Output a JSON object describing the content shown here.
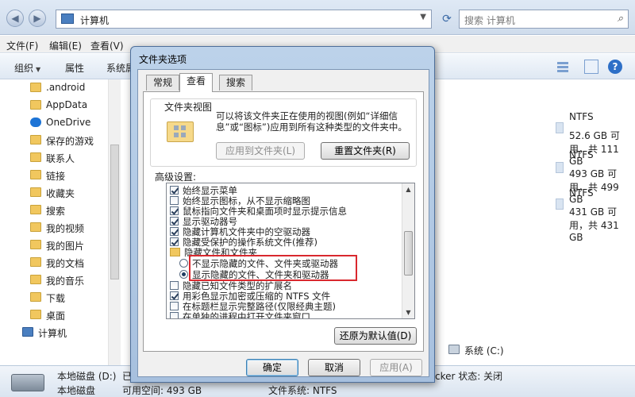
{
  "explorer": {
    "breadcrumb": "计算机",
    "search_placeholder": "搜索 计算机",
    "menu": [
      "文件(F)",
      "编辑(E)",
      "查看(V)",
      "工具(T)",
      "帮助(H)"
    ],
    "commands": {
      "organize": "组织",
      "properties": "属性",
      "system_properties": "系统属"
    },
    "nav_items": [
      {
        "label": ".android",
        "icon": "folder-icon"
      },
      {
        "label": "AppData",
        "icon": "folder-icon"
      },
      {
        "label": "OneDrive",
        "icon": "cloud-icon"
      },
      {
        "label": "保存的游戏",
        "icon": "folder-icon"
      },
      {
        "label": "联系人",
        "icon": "contacts-icon"
      },
      {
        "label": "链接",
        "icon": "folder-icon"
      },
      {
        "label": "收藏夹",
        "icon": "folder-icon"
      },
      {
        "label": "搜索",
        "icon": "folder-icon"
      },
      {
        "label": "我的视频",
        "icon": "folder-icon"
      },
      {
        "label": "我的图片",
        "icon": "folder-icon"
      },
      {
        "label": "我的文档",
        "icon": "folder-icon"
      },
      {
        "label": "我的音乐",
        "icon": "folder-icon"
      },
      {
        "label": "下载",
        "icon": "folder-icon"
      },
      {
        "label": "桌面",
        "icon": "folder-icon"
      },
      {
        "label": "计算机",
        "icon": "computer-icon"
      },
      {
        "label": "系统 (C:)",
        "icon": "drive-icon"
      }
    ],
    "drives": [
      {
        "fs": "NTFS",
        "size": "52.6 GB 可用，共 111 GB"
      },
      {
        "fs": "NTFS",
        "size": "493 GB 可用，共 499 GB"
      },
      {
        "fs": "NTFS",
        "size": "431 GB 可用，共 431 GB"
      }
    ],
    "details": {
      "name": "本地磁盘 (D:)",
      "used_label": "已",
      "type": "本地磁盘",
      "free_label": "可用空间: 493 GB",
      "fs_label": "文件系统: NTFS",
      "bitlocker": "cker 状态: 关闭"
    }
  },
  "dialog": {
    "title": "文件夹选项",
    "tabs": [
      "常规",
      "查看",
      "搜索"
    ],
    "active_tab": "查看",
    "folder_views": {
      "title": "文件夹视图",
      "description": "可以将该文件夹正在使用的视图(例如“详细信息”或“图标”)应用到所有这种类型的文件夹中。",
      "apply_button": "应用到文件夹(L)",
      "reset_button": "重置文件夹(R)"
    },
    "advanced_label": "高级设置:",
    "advanced_rows": [
      {
        "type": "checkbox",
        "checked": true,
        "text": "始终显示菜单"
      },
      {
        "type": "checkbox",
        "checked": false,
        "text": "始终显示图标，从不显示缩略图"
      },
      {
        "type": "checkbox",
        "checked": true,
        "text": "鼠标指向文件夹和桌面项时显示提示信息"
      },
      {
        "type": "checkbox",
        "checked": true,
        "text": "显示驱动器号"
      },
      {
        "type": "checkbox",
        "checked": true,
        "text": "隐藏计算机文件夹中的空驱动器"
      },
      {
        "type": "checkbox",
        "checked": true,
        "text": "隐藏受保护的操作系统文件(推荐)"
      },
      {
        "type": "folder",
        "text": "隐藏文件和文件夹"
      },
      {
        "type": "radio",
        "checked": false,
        "text": "不显示隐藏的文件、文件夹或驱动器"
      },
      {
        "type": "radio",
        "checked": true,
        "text": "显示隐藏的文件、文件夹和驱动器"
      },
      {
        "type": "checkbox",
        "checked": false,
        "text": "隐藏已知文件类型的扩展名"
      },
      {
        "type": "checkbox",
        "checked": true,
        "text": "用彩色显示加密或压缩的 NTFS 文件"
      },
      {
        "type": "checkbox",
        "checked": false,
        "text": "在标题栏显示完整路径(仅限经典主题)"
      },
      {
        "type": "checkbox",
        "checked": false,
        "text": "在单独的进程中打开文件夹窗口"
      }
    ],
    "restore_button": "还原为默认值(D)",
    "ok_button": "确定",
    "cancel_button": "取消",
    "apply_button": "应用(A)"
  },
  "colors": {
    "highlight": "#d9282e",
    "title_bar": "#bcd2ea"
  }
}
